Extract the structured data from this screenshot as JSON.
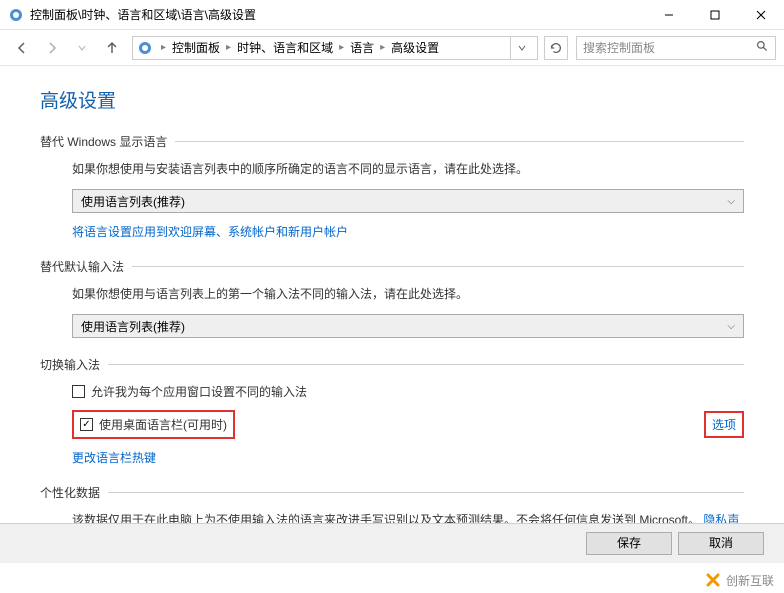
{
  "window": {
    "title": "控制面板\\时钟、语言和区域\\语言\\高级设置"
  },
  "breadcrumb": {
    "root": "控制面板",
    "part1": "时钟、语言和区域",
    "part2": "语言",
    "part3": "高级设置"
  },
  "search": {
    "placeholder": "搜索控制面板"
  },
  "page": {
    "title": "高级设置"
  },
  "section1": {
    "title": "替代 Windows 显示语言",
    "desc": "如果你想使用与安装语言列表中的顺序所确定的语言不同的显示语言，请在此处选择。",
    "select": "使用语言列表(推荐)",
    "link": "将语言设置应用到欢迎屏幕、系统帐户和新用户帐户"
  },
  "section2": {
    "title": "替代默认输入法",
    "desc": "如果你想使用与语言列表上的第一个输入法不同的输入法，请在此处选择。",
    "select": "使用语言列表(推荐)"
  },
  "section3": {
    "title": "切换输入法",
    "checkbox1": "允许我为每个应用窗口设置不同的输入法",
    "checkbox2": "使用桌面语言栏(可用时)",
    "options": "选项",
    "link": "更改语言栏热键"
  },
  "section4": {
    "title": "个性化数据",
    "desc_part1": "该数据仅用于在此电脑上为不使用输入法的语言来改进手写识别以及文本预测结果。不会将任何信息发送到 Microsoft。",
    "privacy": "隐私声明"
  },
  "buttons": {
    "save": "保存",
    "cancel": "取消"
  },
  "watermark": {
    "text": "创新互联"
  }
}
